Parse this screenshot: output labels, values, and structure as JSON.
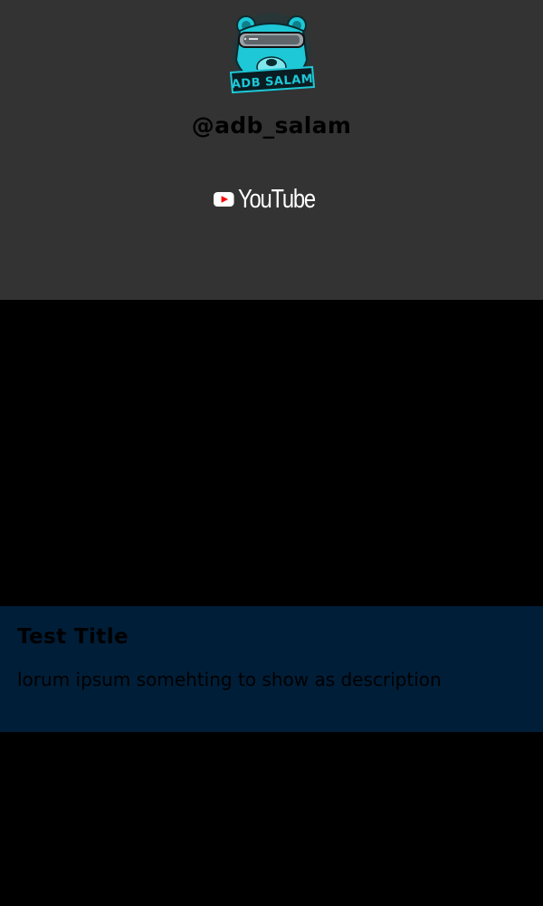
{
  "profile": {
    "logo_icon": "bear-vr-mascot-icon",
    "logo_text": "ADB SALAM",
    "handle": "@adb_salam"
  },
  "social": {
    "youtube_icon": "youtube-play-icon",
    "youtube_label": "YouTube"
  },
  "card": {
    "title": "Test Title",
    "description": "lorum ipsum somehting to show as description"
  },
  "colors": {
    "header_bg": "#333333",
    "page_bg": "#000000",
    "info_band_bg": "#001e38",
    "logo_accent": "#1ec8d6",
    "youtube_red": "#ff0000"
  }
}
